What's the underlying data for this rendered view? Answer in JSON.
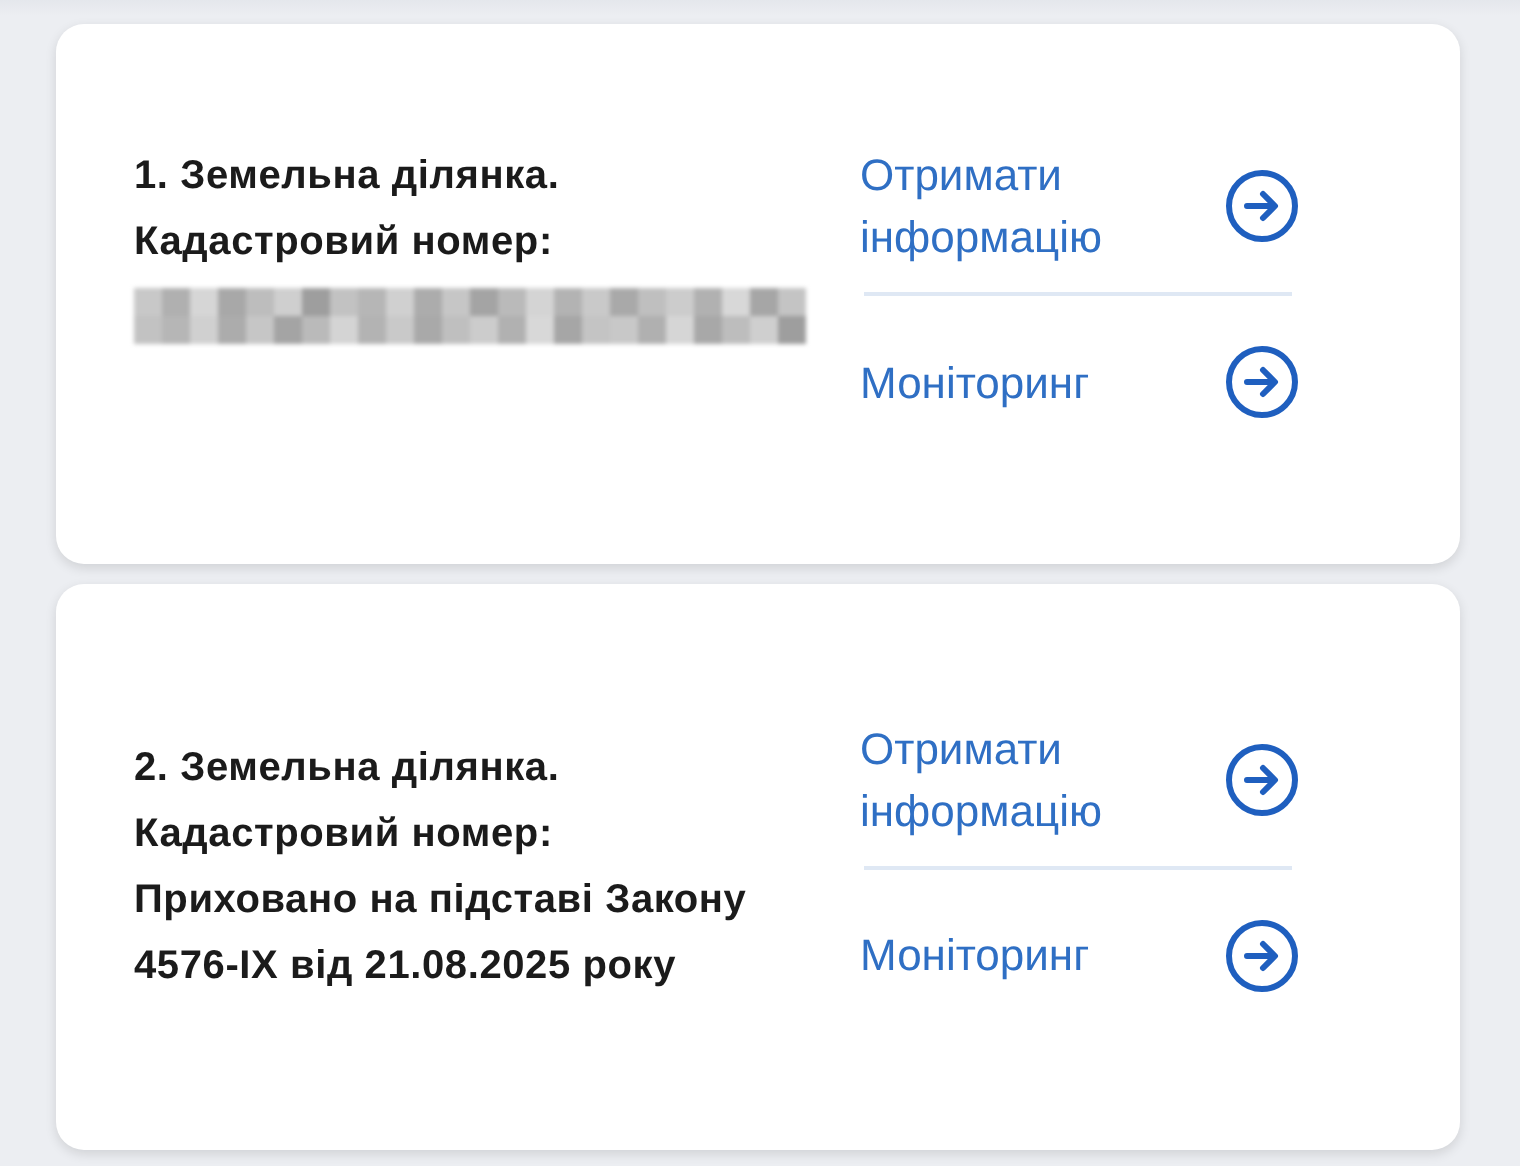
{
  "parcels": [
    {
      "title": "1. Земельна ділянка.",
      "label": "Кадастровий номер:",
      "redacted": true,
      "actions": [
        {
          "label": "Отримати інформацію"
        },
        {
          "label": "Моніторинг"
        }
      ]
    },
    {
      "title": "2. Земельна ділянка.",
      "label": "Кадастровий номер:",
      "redacted": false,
      "value": "Приховано на підставі Закону 4576-IX від 21.08.2025 року",
      "actions": [
        {
          "label": "Отримати інформацію"
        },
        {
          "label": "Моніторинг"
        }
      ]
    }
  ]
}
